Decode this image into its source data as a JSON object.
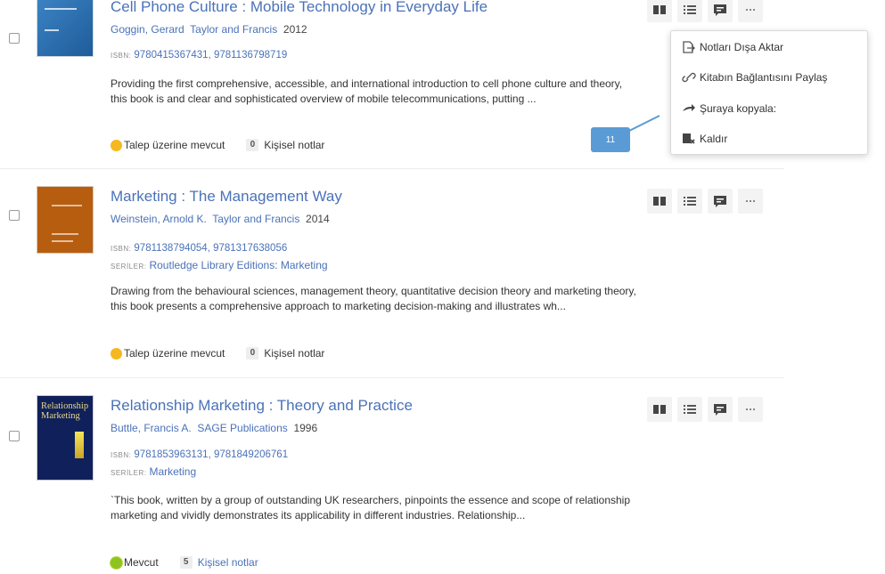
{
  "records": [
    {
      "title": "Cell Phone Culture : Mobile Technology in Everyday Life",
      "authors": "Goggin, Gerard",
      "publisher": "Taylor and Francis",
      "year": "2012",
      "isbn_label": "ISBN:",
      "isbn": "9780415367431, 9781136798719",
      "description": "Providing the first comprehensive, accessible, and international introduction to cell phone culture and theory, this book is and clear and sophisticated overview of mobile telecommunications, putting ...",
      "availability": "Talep üzerine mevcut",
      "notes_count": "0",
      "notes_label": "Kişisel notlar"
    },
    {
      "title": "Marketing : The Management Way",
      "authors": "Weinstein, Arnold K.",
      "publisher": "Taylor and Francis",
      "year": "2014",
      "isbn_label": "ISBN:",
      "isbn": "9781138794054, 9781317638056",
      "series_label": "SERİLER:",
      "series": "Routledge Library Editions: Marketing",
      "description": "Drawing from the behavioural sciences, management theory, quantitative decision theory and marketing theory, this book presents a comprehensive approach to marketing decision-making and illustrates wh...",
      "availability": "Talep üzerine mevcut",
      "notes_count": "0",
      "notes_label": "Kişisel notlar"
    },
    {
      "title": "Relationship Marketing : Theory and Practice",
      "authors": "Buttle, Francis A.",
      "publisher": "SAGE Publications",
      "year": "1996",
      "isbn_label": "ISBN:",
      "isbn": "9781853963131, 9781849206761",
      "series_label": "SERİLER:",
      "series": "Marketing",
      "description": "`This book, written by a group of outstanding UK researchers, pinpoints the essence and scope of relationship marketing and vividly demonstrates its applicability in different industries. Relationship...",
      "availability": "Mevcut",
      "notes_count": "5",
      "notes_label": "Kişisel notlar",
      "cover_text": "Relationship Marketing"
    }
  ],
  "menu": {
    "export_notes": "Notları Dışa Aktar",
    "share_link": "Kitabın Bağlantısını Paylaş",
    "copy_to": "Şuraya kopyala:",
    "remove": "Kaldır"
  },
  "callout": {
    "number": "11"
  },
  "colors": {
    "link": "#4b72b8",
    "available_on_request": "#f5b820",
    "available": "#8fc31f",
    "callout": "#5b9bd5"
  },
  "icons": [
    "book-icon",
    "list-icon",
    "comment-icon",
    "more-icon",
    "export-icon",
    "link-icon",
    "copy-arrow-icon",
    "remove-icon"
  ]
}
